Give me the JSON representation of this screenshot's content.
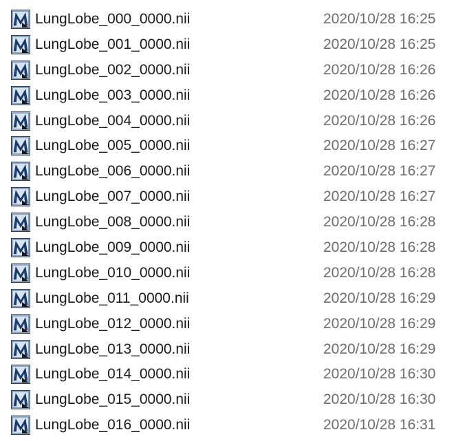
{
  "file_icon": "matlab-file-icon",
  "files": [
    {
      "name": "LungLobe_000_0000.nii",
      "modified": "2020/10/28 16:25"
    },
    {
      "name": "LungLobe_001_0000.nii",
      "modified": "2020/10/28 16:25"
    },
    {
      "name": "LungLobe_002_0000.nii",
      "modified": "2020/10/28 16:26"
    },
    {
      "name": "LungLobe_003_0000.nii",
      "modified": "2020/10/28 16:26"
    },
    {
      "name": "LungLobe_004_0000.nii",
      "modified": "2020/10/28 16:26"
    },
    {
      "name": "LungLobe_005_0000.nii",
      "modified": "2020/10/28 16:27"
    },
    {
      "name": "LungLobe_006_0000.nii",
      "modified": "2020/10/28 16:27"
    },
    {
      "name": "LungLobe_007_0000.nii",
      "modified": "2020/10/28 16:27"
    },
    {
      "name": "LungLobe_008_0000.nii",
      "modified": "2020/10/28 16:28"
    },
    {
      "name": "LungLobe_009_0000.nii",
      "modified": "2020/10/28 16:28"
    },
    {
      "name": "LungLobe_010_0000.nii",
      "modified": "2020/10/28 16:28"
    },
    {
      "name": "LungLobe_011_0000.nii",
      "modified": "2020/10/28 16:29"
    },
    {
      "name": "LungLobe_012_0000.nii",
      "modified": "2020/10/28 16:29"
    },
    {
      "name": "LungLobe_013_0000.nii",
      "modified": "2020/10/28 16:29"
    },
    {
      "name": "LungLobe_014_0000.nii",
      "modified": "2020/10/28 16:30"
    },
    {
      "name": "LungLobe_015_0000.nii",
      "modified": "2020/10/28 16:30"
    },
    {
      "name": "LungLobe_016_0000.nii",
      "modified": "2020/10/28 16:31"
    }
  ]
}
